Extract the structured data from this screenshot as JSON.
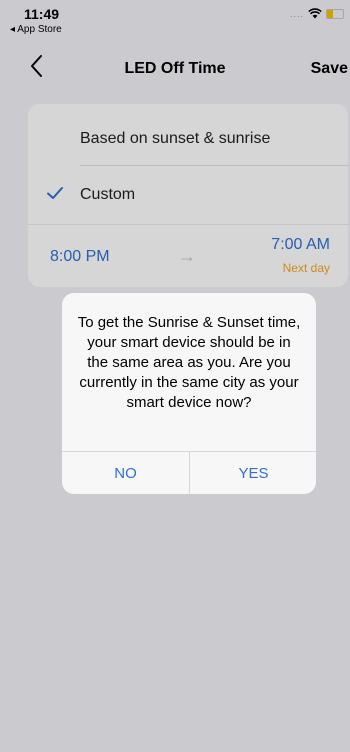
{
  "status_bar": {
    "time": "11:49",
    "back_app": "◂ App Store",
    "signal_dots": "....",
    "wifi_icon": "wifi-icon",
    "battery_color": "#f5c400"
  },
  "nav": {
    "back_icon": "chevron-left-icon",
    "title": "LED Off Time",
    "save_label": "Save"
  },
  "options": {
    "sunset_sunrise_label": "Based on sunset & sunrise",
    "custom_label": "Custom",
    "custom_selected": true,
    "check_icon": "checkmark-icon",
    "accent_color": "#2f6fd6"
  },
  "time_range": {
    "start": "8:00 PM",
    "arrow": "→",
    "end": "7:00 AM",
    "end_note": "Next day",
    "note_color": "#f5a623"
  },
  "alert": {
    "message": "To get the Sunrise & Sunset time, your smart device should be in the same area as you. Are you currently in the same city as your smart device now?",
    "no_label": "NO",
    "yes_label": "YES"
  }
}
